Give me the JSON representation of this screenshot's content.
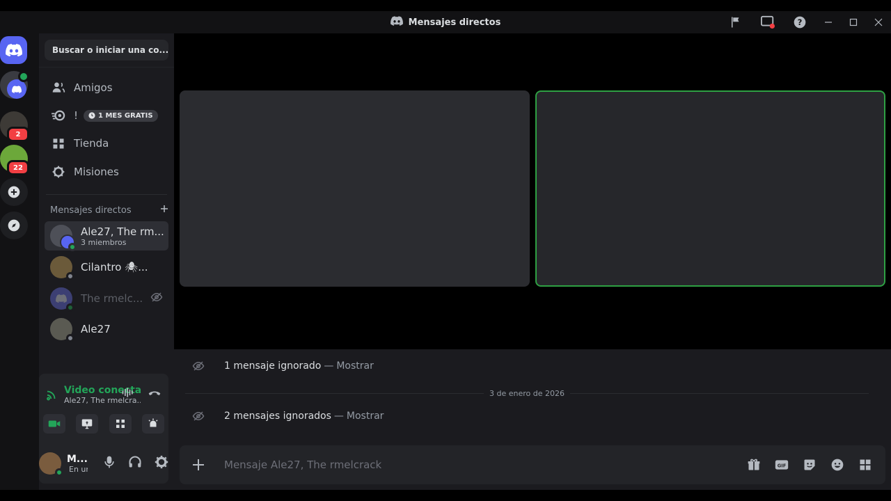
{
  "window": {
    "title": "Mensajes directos"
  },
  "sidebar": {
    "search_label": "Buscar o iniciar una co...",
    "nav": [
      {
        "label": "Amigos",
        "icon": "friends-icon"
      },
      {
        "label": "!",
        "icon": "nitro-icon",
        "promo": "1 MES GRATIS"
      },
      {
        "label": "Tienda",
        "icon": "shop-icon"
      },
      {
        "label": "Misiones",
        "icon": "quests-icon"
      }
    ],
    "dm_header": "Mensajes directos",
    "dms": [
      {
        "name": "Ale27, The rm...",
        "sub": "3 miembros",
        "status": "online",
        "active": true
      },
      {
        "name": "Cilantro 🕷...",
        "sub": "",
        "status": "offline",
        "active": false
      },
      {
        "name": "The rmelc...",
        "sub": "",
        "status": "online",
        "active": false,
        "muted": true
      },
      {
        "name": "Ale27",
        "sub": "",
        "status": "offline",
        "active": false
      }
    ]
  },
  "rail": {
    "badges": [
      "2",
      "22"
    ]
  },
  "voice": {
    "title": "Video conectado",
    "sub": "Ale27, The rmelcra..."
  },
  "user": {
    "name": "M...",
    "sub": "En un..."
  },
  "chat": {
    "ignored1": {
      "text": "1 mensaje ignorado",
      "dash": "—",
      "show": "Mostrar"
    },
    "date": "3 de enero de 2026",
    "ignored2": {
      "text": "2 mensajes ignorados",
      "dash": "—",
      "show": "Mostrar"
    },
    "placeholder": "Mensaje Ale27, The rmelcrack"
  },
  "colors": {
    "accent": "#5865f2",
    "online": "#23a559",
    "badge": "#f23f43",
    "speaking_border": "#2ea043"
  }
}
